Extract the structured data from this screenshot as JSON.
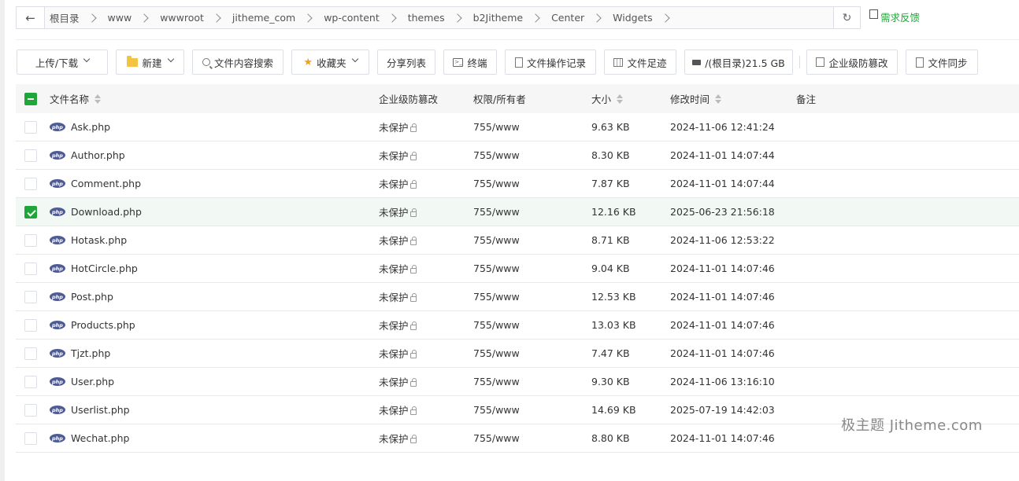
{
  "breadcrumb": [
    "根目录",
    "www",
    "wwwroot",
    "jitheme_com",
    "wp-content",
    "themes",
    "b2Jitheme",
    "Center",
    "Widgets"
  ],
  "feedback_label": "需求反馈",
  "toolbar": {
    "upload": "上传/下载",
    "new": "新建",
    "content_search": "文件内容搜索",
    "favorites": "收藏夹",
    "share_list": "分享列表",
    "terminal": "终端",
    "op_log": "文件操作记录",
    "footprint": "文件足迹",
    "disk": "/(根目录)21.5 GB",
    "tamper": "企业级防篡改",
    "sync": "文件同步"
  },
  "table": {
    "headers": {
      "name": "文件名称",
      "protect": "企业级防篡改",
      "perm": "权限/所有者",
      "size": "大小",
      "mtime": "修改时间",
      "note": "备注"
    },
    "rows": [
      {
        "name": "Ask.php",
        "protect": "未保护",
        "perm": "755/www",
        "size": "9.63 KB",
        "mtime": "2024-11-06 12:41:24",
        "checked": false
      },
      {
        "name": "Author.php",
        "protect": "未保护",
        "perm": "755/www",
        "size": "8.30 KB",
        "mtime": "2024-11-01 14:07:44",
        "checked": false
      },
      {
        "name": "Comment.php",
        "protect": "未保护",
        "perm": "755/www",
        "size": "7.87 KB",
        "mtime": "2024-11-01 14:07:44",
        "checked": false
      },
      {
        "name": "Download.php",
        "protect": "未保护",
        "perm": "755/www",
        "size": "12.16 KB",
        "mtime": "2025-06-23 21:56:18",
        "checked": true
      },
      {
        "name": "Hotask.php",
        "protect": "未保护",
        "perm": "755/www",
        "size": "8.71 KB",
        "mtime": "2024-11-06 12:53:22",
        "checked": false
      },
      {
        "name": "HotCircle.php",
        "protect": "未保护",
        "perm": "755/www",
        "size": "9.04 KB",
        "mtime": "2024-11-01 14:07:46",
        "checked": false
      },
      {
        "name": "Post.php",
        "protect": "未保护",
        "perm": "755/www",
        "size": "12.53 KB",
        "mtime": "2024-11-01 14:07:46",
        "checked": false
      },
      {
        "name": "Products.php",
        "protect": "未保护",
        "perm": "755/www",
        "size": "13.03 KB",
        "mtime": "2024-11-01 14:07:46",
        "checked": false
      },
      {
        "name": "Tjzt.php",
        "protect": "未保护",
        "perm": "755/www",
        "size": "7.47 KB",
        "mtime": "2024-11-01 14:07:46",
        "checked": false
      },
      {
        "name": "User.php",
        "protect": "未保护",
        "perm": "755/www",
        "size": "9.30 KB",
        "mtime": "2024-11-06 13:16:10",
        "checked": false
      },
      {
        "name": "Userlist.php",
        "protect": "未保护",
        "perm": "755/www",
        "size": "14.69 KB",
        "mtime": "2025-07-19 14:42:03",
        "checked": false
      },
      {
        "name": "Wechat.php",
        "protect": "未保护",
        "perm": "755/www",
        "size": "8.80 KB",
        "mtime": "2024-11-01 14:07:46",
        "checked": false
      }
    ]
  },
  "file_icon_label": "php",
  "watermark": "极主题 Jitheme.com",
  "colors": {
    "accent": "#20a53a",
    "php_icon": "#4f5b93",
    "selected_row": "#f2f9f5"
  }
}
